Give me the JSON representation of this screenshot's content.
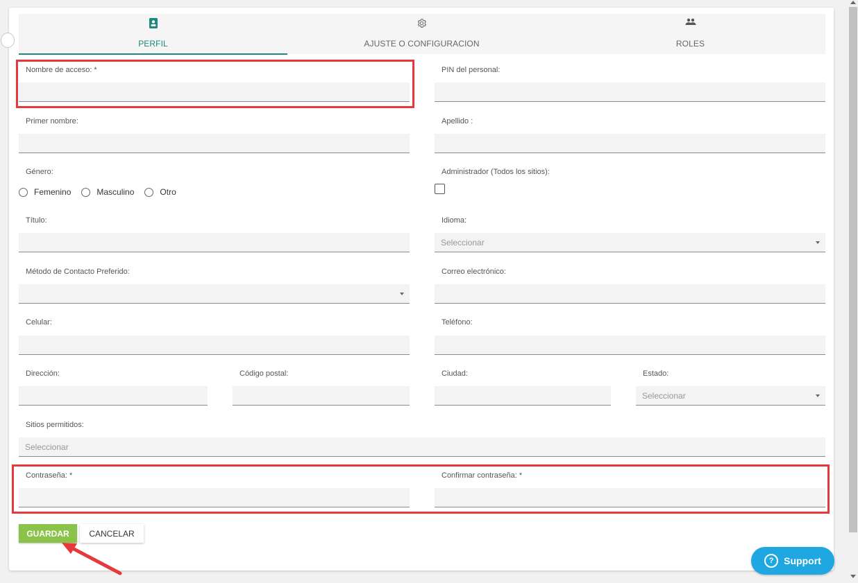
{
  "tabs": [
    {
      "label": "PERFIL",
      "icon": "profile-badge-icon",
      "active": true
    },
    {
      "label": "AJUSTE O CONFIGURACION",
      "icon": "gear-icon",
      "active": false
    },
    {
      "label": "ROLES",
      "icon": "people-icon",
      "active": false
    }
  ],
  "form": {
    "login_name": {
      "label": "Nombre de acceso: *",
      "value": ""
    },
    "staff_pin": {
      "label": "PIN del personal:",
      "value": ""
    },
    "first_name": {
      "label": "Primer nombre:",
      "value": ""
    },
    "last_name": {
      "label": "Apellido :",
      "value": ""
    },
    "gender": {
      "label": "Género:",
      "options": [
        "Femenino",
        "Masculino",
        "Otro"
      ]
    },
    "admin": {
      "label": "Administrador (Todos los sitios):",
      "checked": false
    },
    "title": {
      "label": "Título:",
      "value": ""
    },
    "language": {
      "label": "Idioma:",
      "placeholder": "Seleccionar"
    },
    "contact_method": {
      "label": "Método de Contacto Preferido:",
      "value": ""
    },
    "email": {
      "label": "Correo electrónico:",
      "value": ""
    },
    "mobile": {
      "label": "Celular:",
      "value": ""
    },
    "phone": {
      "label": "Teléfono:",
      "value": ""
    },
    "address": {
      "label": "Dirección:",
      "value": ""
    },
    "postal_code": {
      "label": "Código postal:",
      "value": ""
    },
    "city": {
      "label": "Ciudad:",
      "value": ""
    },
    "state": {
      "label": "Estado:",
      "placeholder": "Seleccionar"
    },
    "allowed_sites": {
      "label": "Sitios permitidos:",
      "placeholder": "Seleccionar"
    },
    "password": {
      "label": "Contraseña: *",
      "value": ""
    },
    "confirm_password": {
      "label": "Confirmar contraseña: *",
      "value": ""
    }
  },
  "buttons": {
    "save": "GUARDAR",
    "cancel": "CANCELAR"
  },
  "support": {
    "label": "Support",
    "icon": "question-circle-icon"
  },
  "colors": {
    "accent": "#1a8a7a",
    "save_button": "#8bc34a",
    "highlight": "#e5393b",
    "support": "#1ea7e1"
  }
}
